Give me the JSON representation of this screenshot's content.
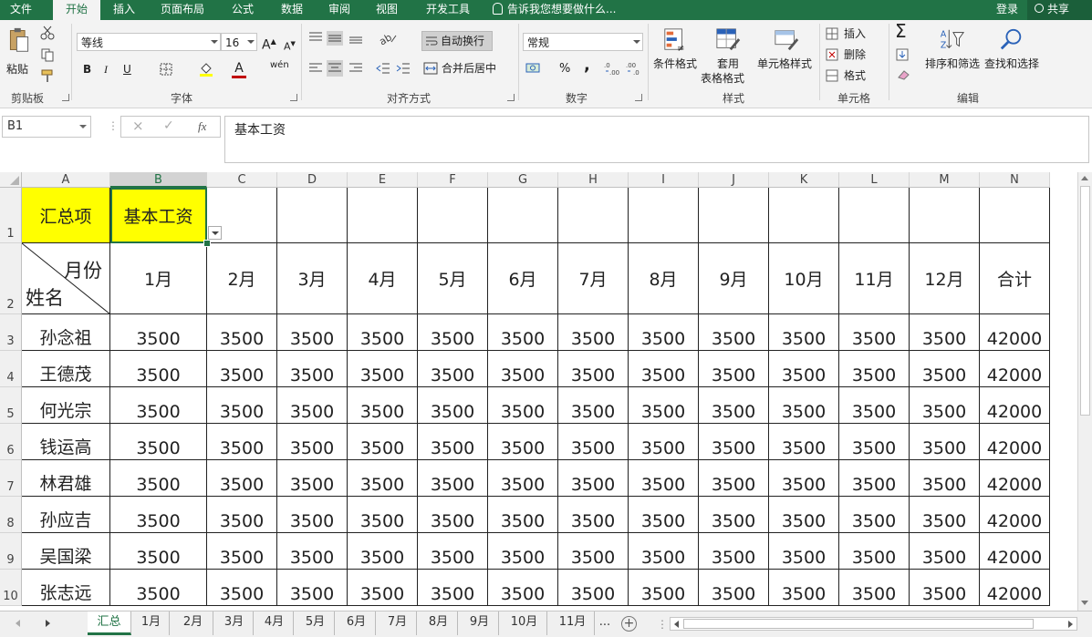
{
  "ribbon_tabs": [
    "文件",
    "开始",
    "插入",
    "页面布局",
    "公式",
    "数据",
    "审阅",
    "视图",
    "开发工具"
  ],
  "active_tab": "开始",
  "tell_me": "告诉我您想要做什么...",
  "login": "登录",
  "share": "共享",
  "groups": {
    "clipboard": {
      "label": "剪贴板",
      "paste": "粘贴"
    },
    "font": {
      "label": "字体",
      "font_name": "等线",
      "font_size": "16",
      "bold": "B",
      "italic": "I",
      "underline": "U",
      "font_grow": "A",
      "font_shrink": "A",
      "font_color_letter": "A",
      "wen": "wén"
    },
    "alignment": {
      "label": "对齐方式",
      "wrap": "自动换行",
      "merge": "合并后居中"
    },
    "number": {
      "label": "数字",
      "format": "常规",
      "percent": "%",
      "comma": ","
    },
    "styles": {
      "label": "样式",
      "conditional": "条件格式",
      "table_fmt_1": "套用",
      "table_fmt_2": "表格格式",
      "cell_styles": "单元格样式"
    },
    "cells": {
      "label": "单元格",
      "insert": "插入",
      "delete": "删除",
      "format": "格式"
    },
    "editing": {
      "label": "编辑",
      "sort": "排序和筛选",
      "find": "查找和选择"
    }
  },
  "formula_bar": {
    "name_box": "B1",
    "fx": "fx",
    "cancel": "×",
    "enter": "✓",
    "content": "基本工资"
  },
  "columns": [
    "A",
    "B",
    "C",
    "D",
    "E",
    "F",
    "G",
    "H",
    "I",
    "J",
    "K",
    "L",
    "M",
    "N"
  ],
  "selected_column": "B",
  "rows": {
    "row1": {
      "a": "汇总项",
      "b": "基本工资"
    },
    "row2": {
      "diag_top": "月份",
      "diag_bottom": "姓名",
      "months": [
        "1月",
        "2月",
        "3月",
        "4月",
        "5月",
        "6月",
        "7月",
        "8月",
        "9月",
        "10月",
        "11月",
        "12月",
        "合计"
      ]
    },
    "data": [
      {
        "name": "孙念祖",
        "values": [
          "3500",
          "3500",
          "3500",
          "3500",
          "3500",
          "3500",
          "3500",
          "3500",
          "3500",
          "3500",
          "3500",
          "3500",
          "42000"
        ]
      },
      {
        "name": "王德茂",
        "values": [
          "3500",
          "3500",
          "3500",
          "3500",
          "3500",
          "3500",
          "3500",
          "3500",
          "3500",
          "3500",
          "3500",
          "3500",
          "42000"
        ]
      },
      {
        "name": "何光宗",
        "values": [
          "3500",
          "3500",
          "3500",
          "3500",
          "3500",
          "3500",
          "3500",
          "3500",
          "3500",
          "3500",
          "3500",
          "3500",
          "42000"
        ]
      },
      {
        "name": "钱运高",
        "values": [
          "3500",
          "3500",
          "3500",
          "3500",
          "3500",
          "3500",
          "3500",
          "3500",
          "3500",
          "3500",
          "3500",
          "3500",
          "42000"
        ]
      },
      {
        "name": "林君雄",
        "values": [
          "3500",
          "3500",
          "3500",
          "3500",
          "3500",
          "3500",
          "3500",
          "3500",
          "3500",
          "3500",
          "3500",
          "3500",
          "42000"
        ]
      },
      {
        "name": "孙应吉",
        "values": [
          "3500",
          "3500",
          "3500",
          "3500",
          "3500",
          "3500",
          "3500",
          "3500",
          "3500",
          "3500",
          "3500",
          "3500",
          "42000"
        ]
      },
      {
        "name": "吴国梁",
        "values": [
          "3500",
          "3500",
          "3500",
          "3500",
          "3500",
          "3500",
          "3500",
          "3500",
          "3500",
          "3500",
          "3500",
          "3500",
          "42000"
        ]
      },
      {
        "name": "张志远",
        "values": [
          "3500",
          "3500",
          "3500",
          "3500",
          "3500",
          "3500",
          "3500",
          "3500",
          "3500",
          "3500",
          "3500",
          "3500",
          "42000"
        ]
      }
    ]
  },
  "row_numbers": [
    "1",
    "2",
    "3",
    "4",
    "5",
    "6",
    "7",
    "8",
    "9",
    "10"
  ],
  "sheet_tabs": [
    "汇总",
    "1月",
    "2月",
    "3月",
    "4月",
    "5月",
    "6月",
    "7月",
    "8月",
    "9月",
    "10月",
    "11月",
    "..."
  ],
  "active_sheet": "汇总",
  "add_sheet": "+",
  "colors": {
    "accent": "#217346",
    "highlight": "#ffff00"
  }
}
